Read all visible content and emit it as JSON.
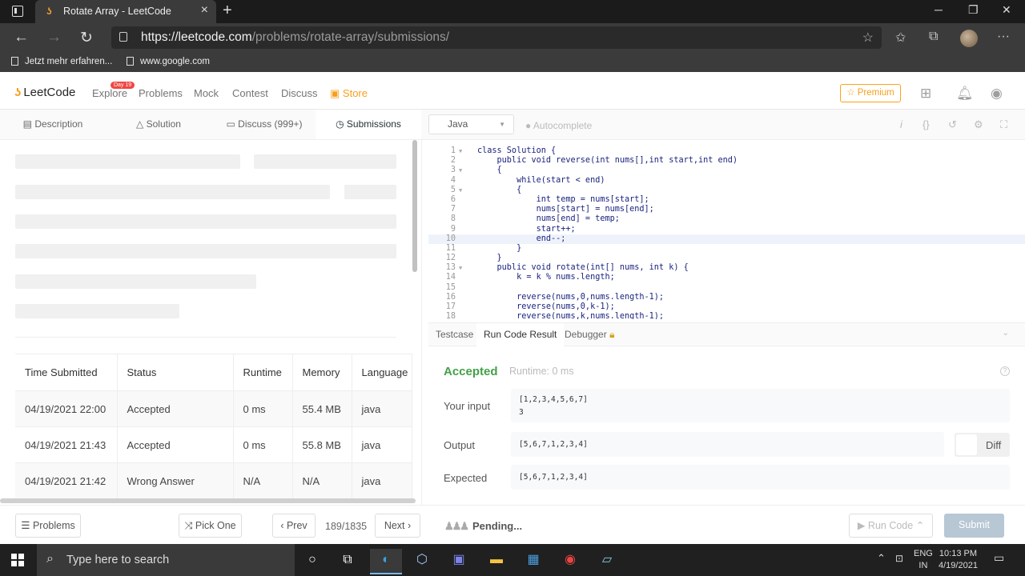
{
  "browser": {
    "tab_title": "Rotate Array - LeetCode",
    "url_host": "https://leetcode.com",
    "url_path": "/problems/rotate-array/submissions/",
    "bookmarks": [
      "Jetzt mehr erfahren...",
      "www.google.com"
    ]
  },
  "lc_nav": {
    "logo": "LeetCode",
    "badge": "Day 19",
    "links": [
      "Explore",
      "Problems",
      "Mock",
      "Contest",
      "Discuss",
      "Store"
    ],
    "premium": "Premium"
  },
  "left_tabs": [
    "Description",
    "Solution",
    "Discuss (999+)",
    "Submissions"
  ],
  "submissions": {
    "headers": [
      "Time Submitted",
      "Status",
      "Runtime",
      "Memory",
      "Language"
    ],
    "rows": [
      {
        "time": "04/19/2021 22:00",
        "status": "Accepted",
        "runtime": "0 ms",
        "memory": "55.4 MB",
        "language": "java"
      },
      {
        "time": "04/19/2021 21:43",
        "status": "Accepted",
        "runtime": "0 ms",
        "memory": "55.8 MB",
        "language": "java"
      },
      {
        "time": "04/19/2021 21:42",
        "status": "Wrong Answer",
        "runtime": "N/A",
        "memory": "N/A",
        "language": "java"
      }
    ]
  },
  "editor": {
    "language": "Java",
    "autocomplete": "Autocomplete",
    "lines": [
      "class Solution {",
      "    public void reverse(int nums[],int start,int end)",
      "    {",
      "        while(start < end)",
      "        {",
      "            int temp = nums[start];",
      "            nums[start] = nums[end];",
      "            nums[end] = temp;",
      "            start++;",
      "            end--;",
      "        }",
      "    }",
      "    public void rotate(int[] nums, int k) {",
      "        k = k % nums.length;",
      "",
      "        reverse(nums,0,nums.length-1);",
      "        reverse(nums,0,k-1);",
      "        reverse(nums,k,nums.length-1);"
    ]
  },
  "console": {
    "tabs": [
      "Testcase",
      "Run Code Result",
      "Debugger"
    ],
    "status": "Accepted",
    "runtime": "Runtime: 0 ms",
    "input_label": "Your input",
    "input_lines": [
      "[1,2,3,4,5,6,7]",
      "3"
    ],
    "output_label": "Output",
    "output": "[5,6,7,1,2,3,4]",
    "expected_label": "Expected",
    "expected": "[5,6,7,1,2,3,4]",
    "diff": "Diff"
  },
  "bottom": {
    "problems": "Problems",
    "pick_one": "Pick One",
    "prev": "Prev",
    "pager": "189/1835",
    "next": "Next",
    "pending": "Pending...",
    "run_code": "Run Code",
    "submit": "Submit"
  },
  "taskbar": {
    "search": "Type here to search",
    "lang": "ENG",
    "region": "IN",
    "time": "10:13 PM",
    "date": "4/19/2021"
  }
}
